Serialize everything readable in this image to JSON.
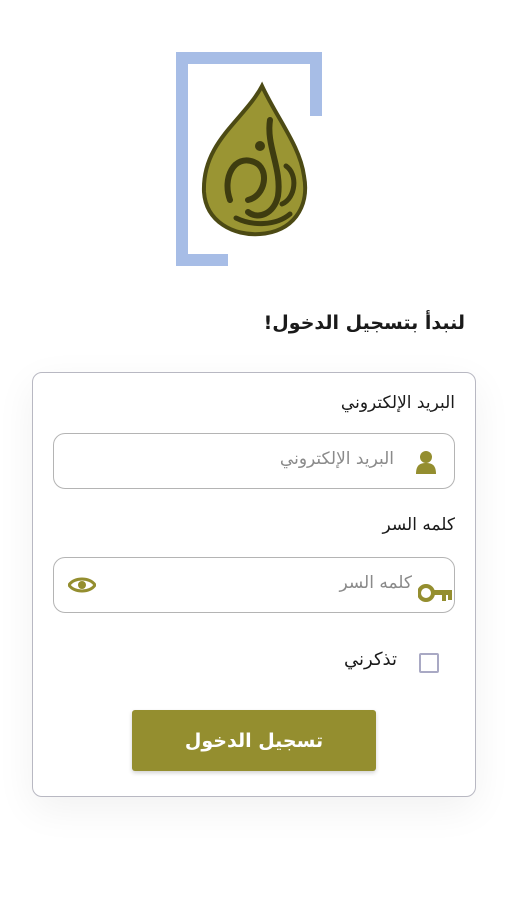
{
  "logo": {
    "name": "logo-mark"
  },
  "heading": "لنبدأ بتسجيل الدخول!",
  "form": {
    "email": {
      "label": "البريد الإلكتروني",
      "placeholder": "البريد الإلكتروني",
      "icon": "user-icon"
    },
    "password": {
      "label": "كلمه السر",
      "placeholder": "كلمه السر",
      "icon": "key-icon",
      "toggle_icon": "eye-icon"
    },
    "remember": {
      "label": "تذكرني",
      "checked": false
    },
    "submit_label": "تسجيل الدخول"
  },
  "colors": {
    "accent": "#948e2f",
    "logo_frame": "#a7bde6",
    "border": "#b4b4b4"
  }
}
